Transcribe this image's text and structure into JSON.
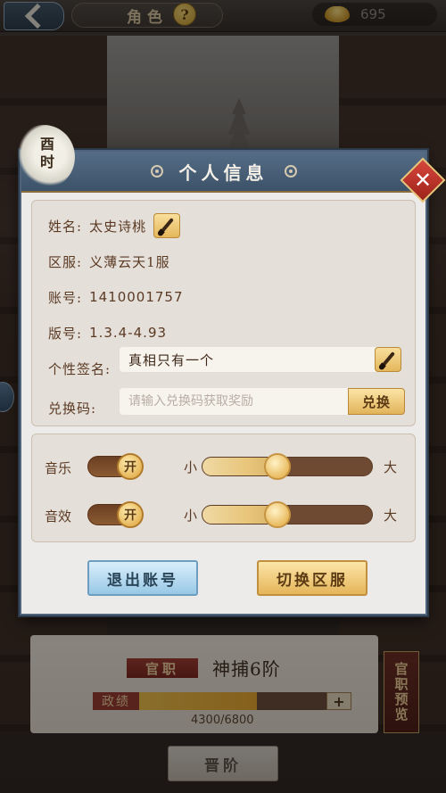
{
  "topbar": {
    "title": "角色",
    "help_symbol": "?",
    "currency_value": "695"
  },
  "dialog": {
    "title": "个人信息",
    "time_badge": "酉时",
    "close_symbol": "✕",
    "name_label": "姓名:",
    "name_value": "太史诗桃",
    "server_label": "区服:",
    "server_value": "义薄云天1服",
    "account_label": "账号:",
    "account_value": "1410001757",
    "version_label": "版号:",
    "version_value": "1.3.4-4.93",
    "signature_label": "个性签名:",
    "signature_value": "真相只有一个",
    "code_label": "兑换码:",
    "code_placeholder": "请输入兑换码获取奖励",
    "redeem_label": "兑换",
    "music_label": "音乐",
    "music_toggle": "开",
    "music_level": 0.44,
    "sfx_label": "音效",
    "sfx_toggle": "开",
    "sfx_level": 0.44,
    "min_label": "小",
    "max_label": "大",
    "logout_label": "退出账号",
    "switch_server_label": "切换区服"
  },
  "background": {
    "rank_badge": "官职",
    "rank_name": "神捕6阶",
    "merit_label": "政绩",
    "merit_value": "4300/6800",
    "merit_progress": 0.63,
    "plus_symbol": "+",
    "preview_label": "官职预览",
    "promote_label": "晋阶"
  }
}
